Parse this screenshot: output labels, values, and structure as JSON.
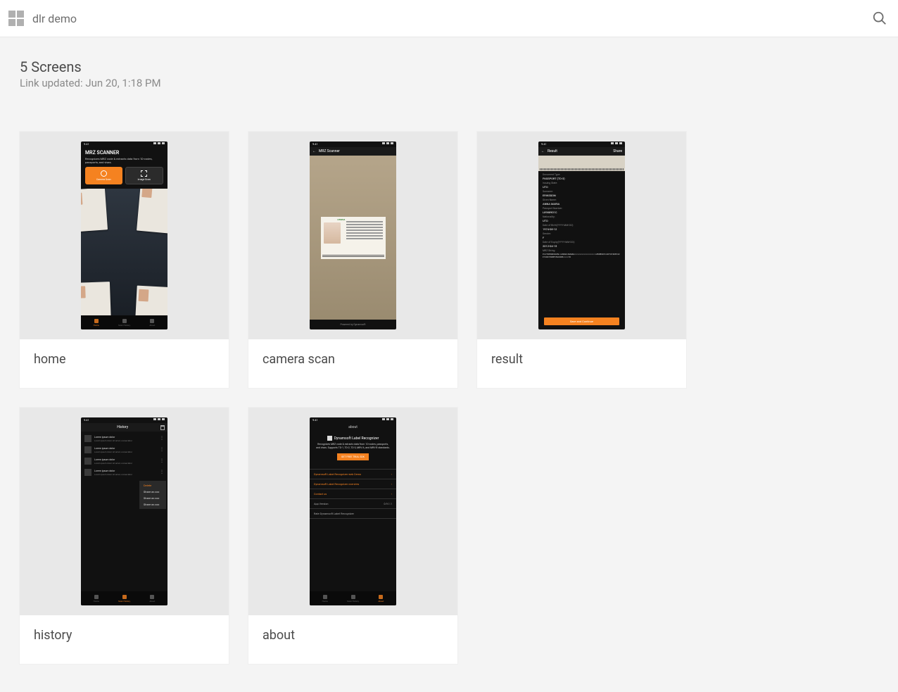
{
  "header": {
    "title": "dlr demo"
  },
  "meta": {
    "screens_count": "5 Screens",
    "updated": "Link updated: Jun 20, 1:18 PM"
  },
  "cards": {
    "home": {
      "label": "home"
    },
    "camera_scan": {
      "label": "camera scan"
    },
    "result": {
      "label": "result"
    },
    "history": {
      "label": "history"
    },
    "about": {
      "label": "about"
    }
  },
  "home_screen": {
    "time": "9:41",
    "title": "MRZ SCANNER",
    "desc": "Recognizes MRZ code & extracts data from 1D-codes, passports, and visas.",
    "camera_btn": "Camera Scan",
    "image_btn": "Image Scan",
    "nav": {
      "home": "Home",
      "history": "Scan History",
      "about": "About"
    }
  },
  "camera_screen": {
    "time": "9:41",
    "title": "MRZ Scanner",
    "country": "UTOPIA",
    "powered_by": "Powered by Dynamsoft"
  },
  "result_screen": {
    "time": "9:41",
    "title": "Result",
    "share": "Share",
    "fields": [
      {
        "label": "Document Type:",
        "value": "PASSPORT (TD-3)"
      },
      {
        "label": "Issuing State:",
        "value": "UTO"
      },
      {
        "label": "Surname:",
        "value": "ERIKSSON"
      },
      {
        "label": "Given Name:",
        "value": "ANNA MARIA"
      },
      {
        "label": "Passport Number:",
        "value": "L8988901C"
      },
      {
        "label": "Nationality:",
        "value": "UTO"
      },
      {
        "label": "Date of Birth(YYYY-MM-DD):",
        "value": "1974-08-12"
      },
      {
        "label": "Gender:",
        "value": "F"
      },
      {
        "label": "Date of Expiry(YYYY-MM-DD):",
        "value": "2012-04-15"
      },
      {
        "label": "MRZ String:",
        "value": ""
      }
    ],
    "mrz_string": "P<UTOERIKSSON<<ANNA<MARIA<<<<<<<<<<<<<<<<<<<\nL8988901C4UTO7408122F1204159ZE184226B<<<<<10",
    "cta": "Save and Continue"
  },
  "history_screen": {
    "time": "9:41",
    "title": "History",
    "rows": [
      {
        "title": "Lorem ipsum dolor",
        "subtitle": "Lorem ipsum dolor sit amet, consectetur"
      },
      {
        "title": "Lorem ipsum dolor",
        "subtitle": "Lorem ipsum dolor sit amet, consectetur"
      },
      {
        "title": "Lorem ipsum dolor",
        "subtitle": "Lorem ipsum dolor sit amet, consectetur"
      },
      {
        "title": "Lorem ipsum dolor",
        "subtitle": "Lorem ipsum dolor sit amet, consectetur"
      }
    ],
    "menu": {
      "delete": "Delete",
      "share1": "Share as xxx",
      "share2": "Share as xxx",
      "share3": "Share as xxx"
    },
    "nav": {
      "home": "Home",
      "history": "Scan History",
      "about": "About"
    }
  },
  "about_screen": {
    "time": "9:41",
    "title": "about",
    "brand": "Dynamsoft Label Recognizer",
    "tagline": "Recognizes MRZ code & extracts data from 1D-codes, passports, and visas. Supports TD-1, TD-2, TD-3, MRV-A, and MRV-B standards.",
    "trial_btn": "GET FREE TRIAL SDK",
    "links": [
      "Dynamsoft Label Recognizer web Demo",
      "Dynamsoft Label Recognizer overview",
      "Contact us"
    ],
    "version_label": "App Version",
    "version_value": "0.9.1.1",
    "rate": "Rate Dynamsoft Label Recognizer",
    "nav": {
      "home": "Home",
      "history": "Scan History",
      "about": "About"
    }
  }
}
